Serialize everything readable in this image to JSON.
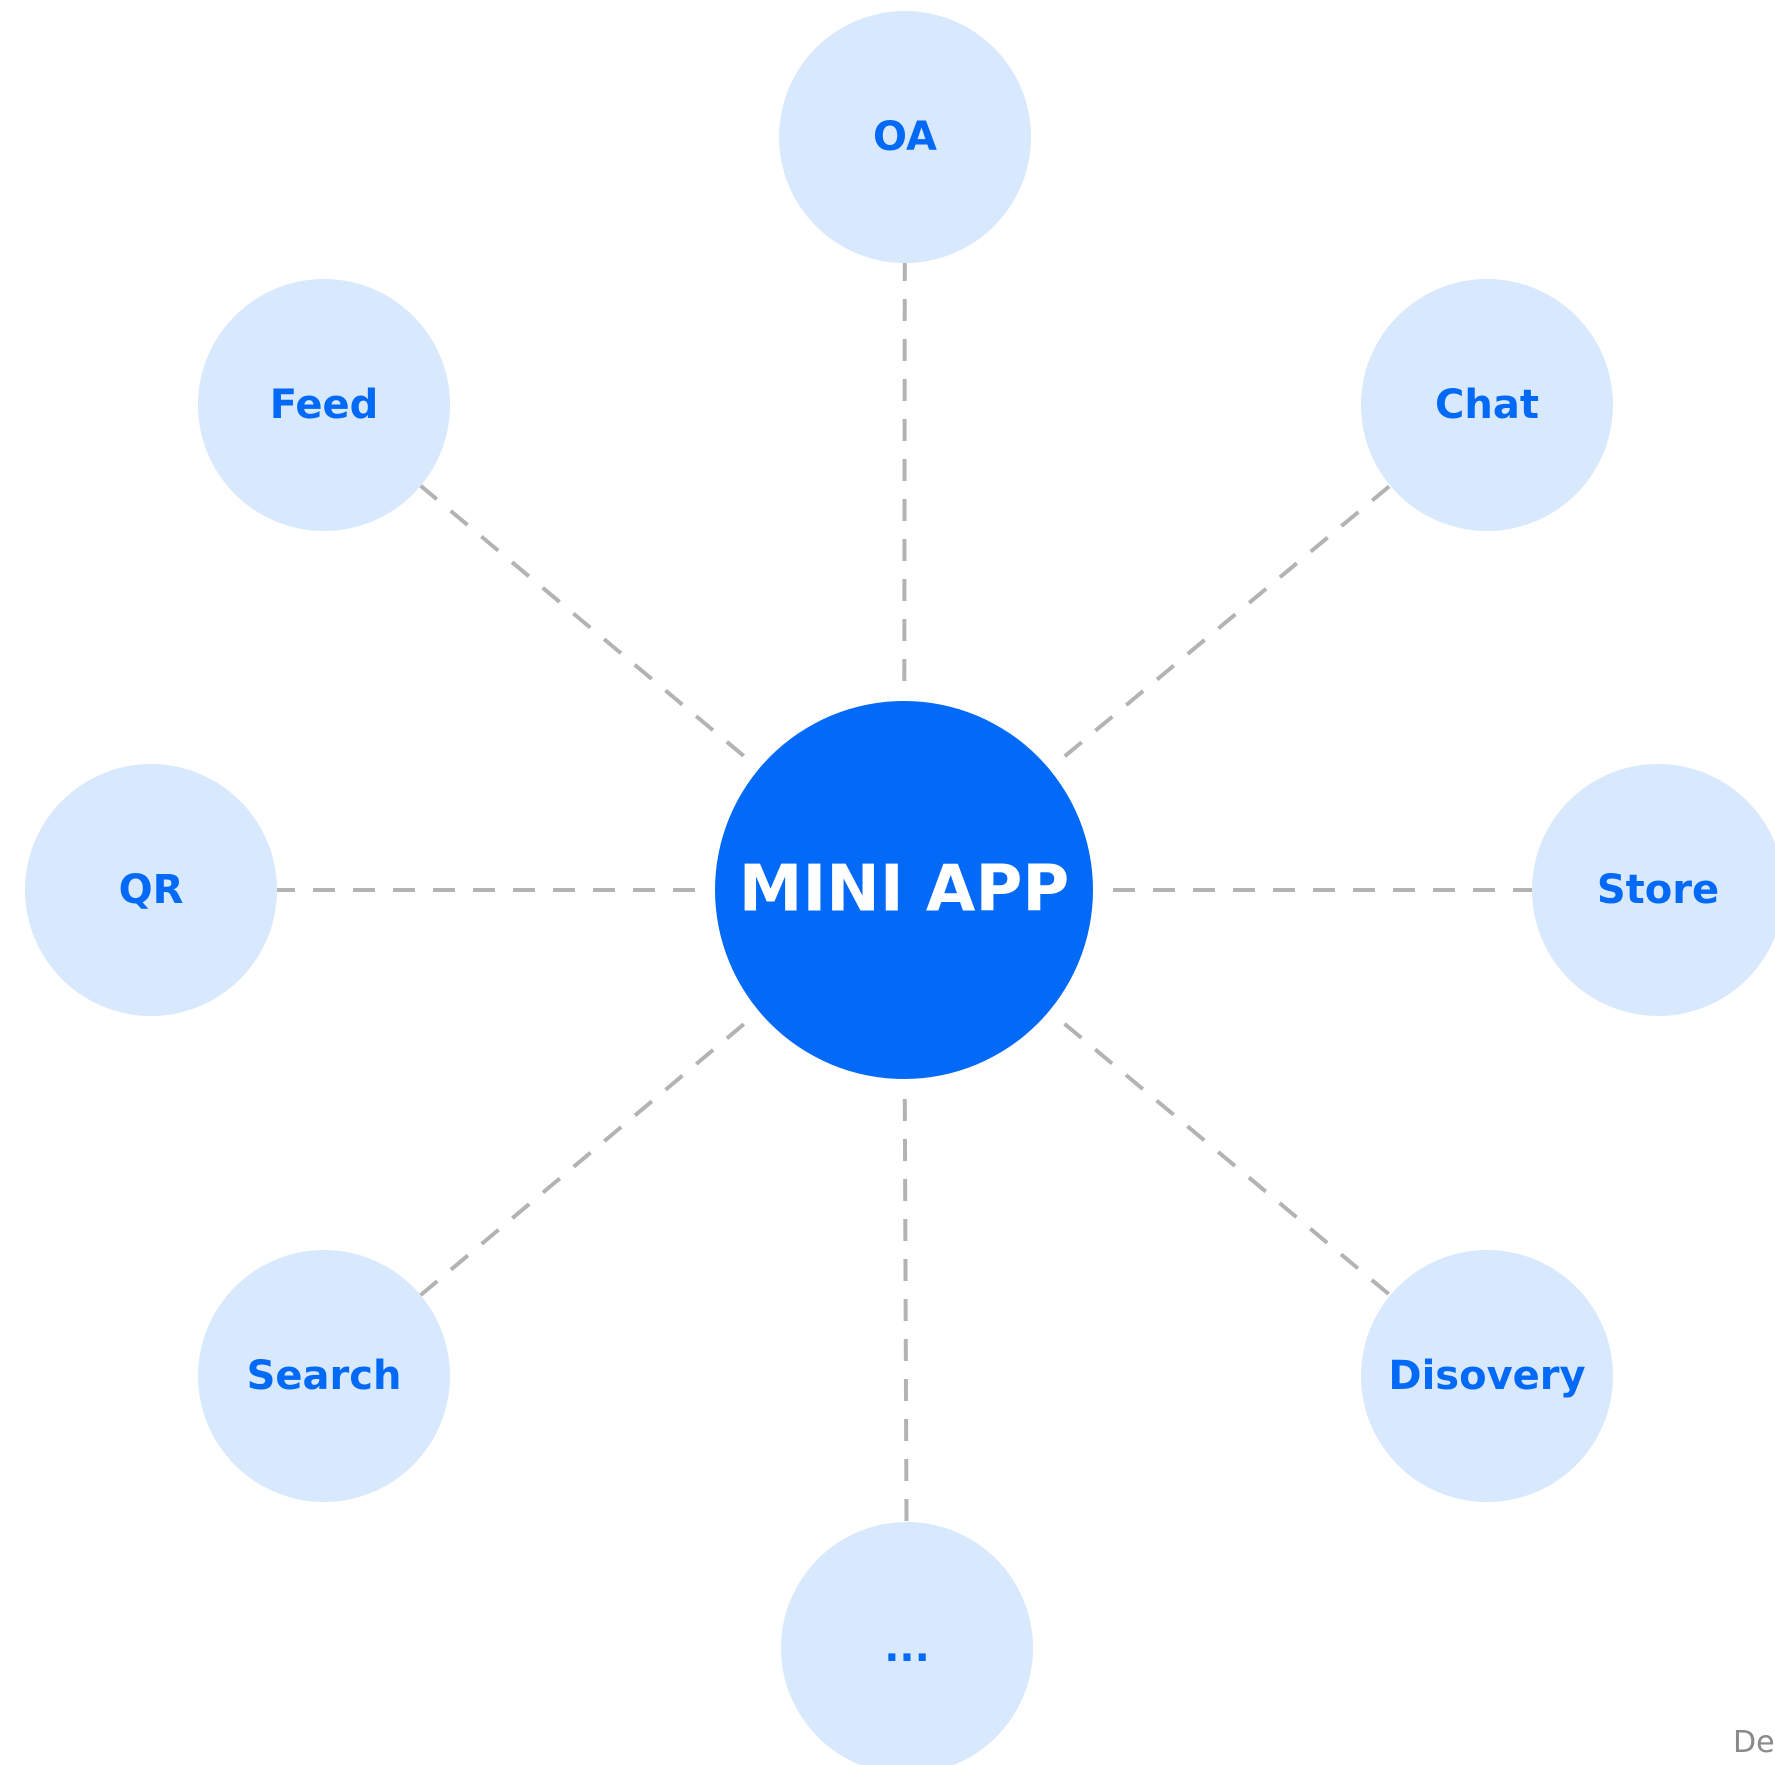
{
  "hub": {
    "label": "MINI APP"
  },
  "nodes": [
    {
      "id": "oa",
      "label": "OA"
    },
    {
      "id": "chat",
      "label": "Chat"
    },
    {
      "id": "store",
      "label": "Store"
    },
    {
      "id": "disovery",
      "label": "Disovery"
    },
    {
      "id": "more",
      "label": "..."
    },
    {
      "id": "search",
      "label": "Search"
    },
    {
      "id": "qr",
      "label": "QR"
    },
    {
      "id": "feed",
      "label": "Feed"
    }
  ],
  "watermark": "De",
  "colors": {
    "hub": "#0369f7",
    "node_fill": "#d8e8fd",
    "node_text": "#0369f7",
    "connector": "#b3b3b6"
  }
}
